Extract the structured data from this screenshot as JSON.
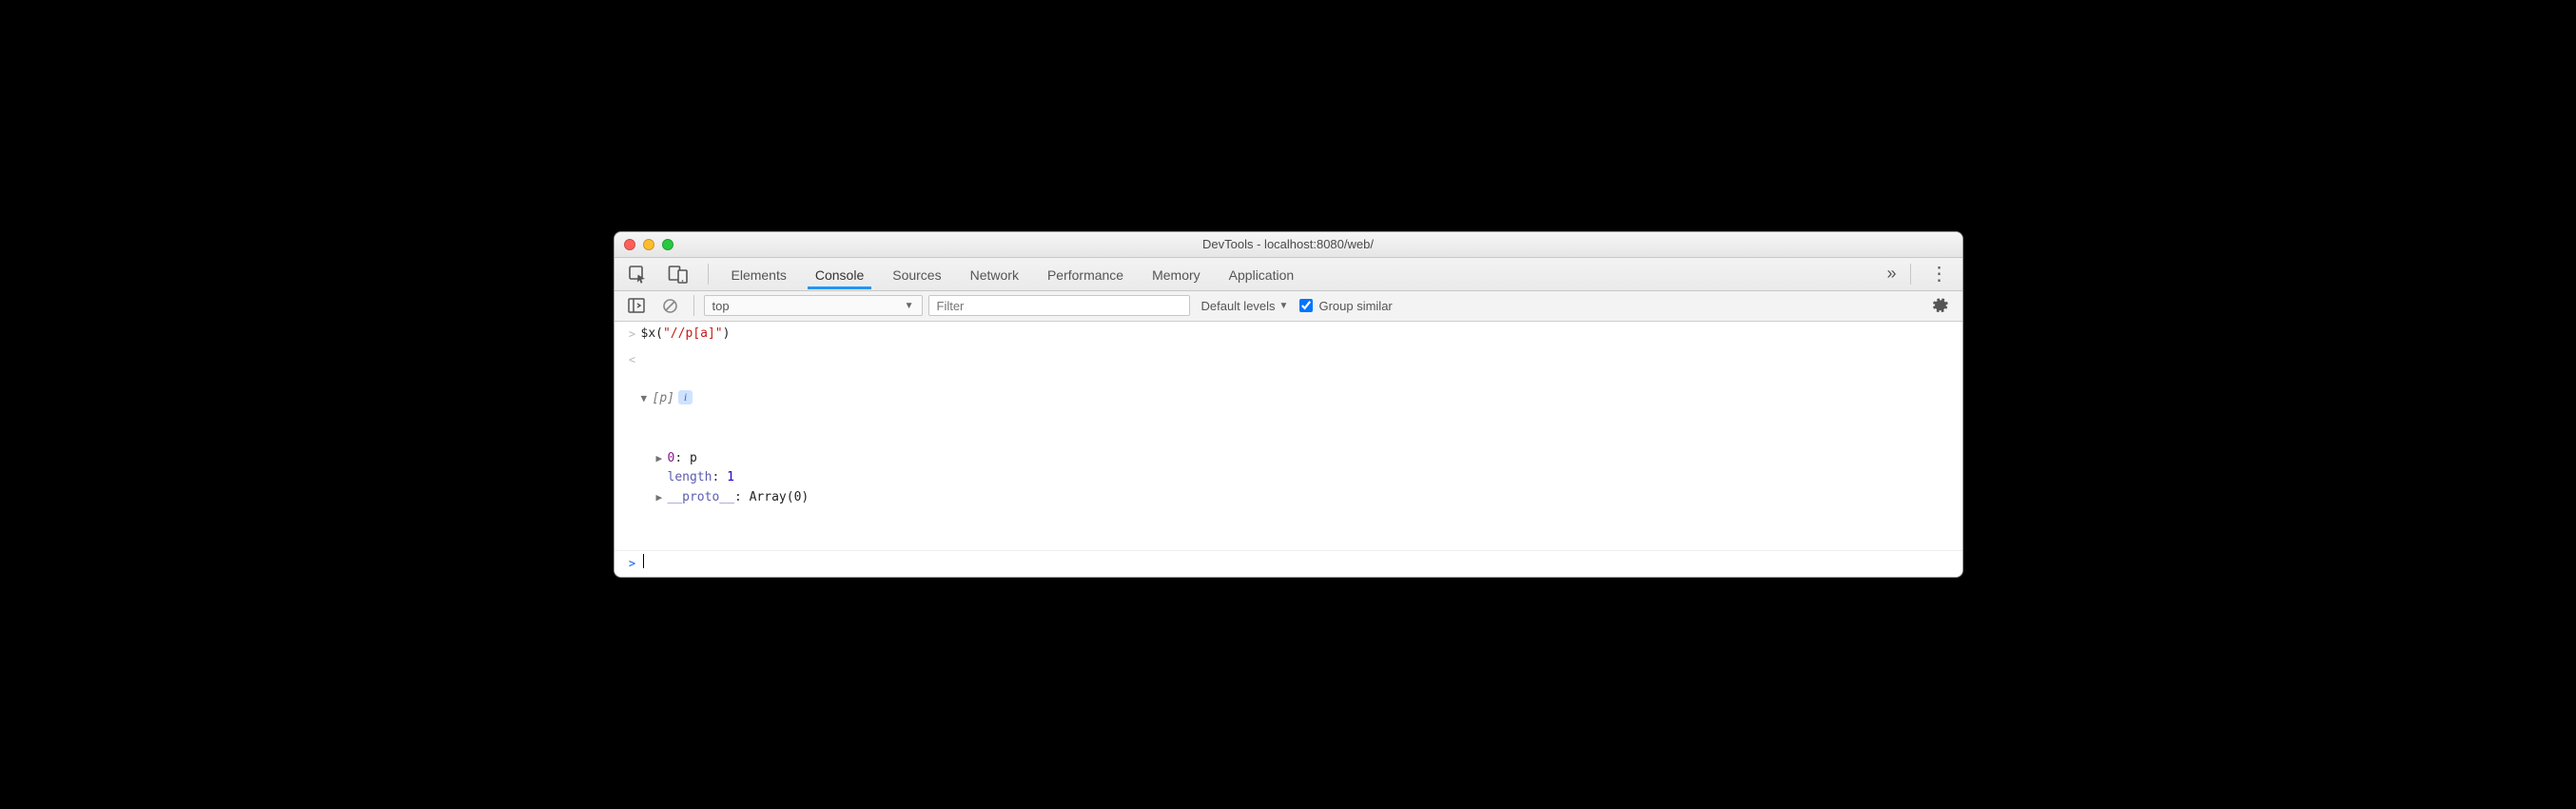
{
  "window": {
    "title": "DevTools - localhost:8080/web/"
  },
  "tabs": [
    "Elements",
    "Console",
    "Sources",
    "Network",
    "Performance",
    "Memory",
    "Application"
  ],
  "active_tab_index": 1,
  "toolbar": {
    "context": "top",
    "filter_placeholder": "Filter",
    "levels_label": "Default levels",
    "group_similar_label": "Group similar",
    "group_similar_checked": true
  },
  "console": {
    "command": {
      "fn": "$x",
      "open": "(",
      "arg": "\"//p[a]\"",
      "close": ")"
    },
    "result": {
      "summary_open": "[",
      "summary_inner": "p",
      "summary_close": "]",
      "props": [
        {
          "expandable": true,
          "key": "0",
          "sep": ": ",
          "val": "p",
          "valClass": "obj-val-o"
        },
        {
          "expandable": false,
          "key": "length",
          "sep": ": ",
          "val": "1",
          "valClass": "obj-val-n"
        },
        {
          "expandable": true,
          "key": "__proto__",
          "sep": ": ",
          "val": "Array(0)",
          "valClass": "obj-val-o"
        }
      ]
    },
    "info_badge": "i",
    "prompt_caret": ">"
  },
  "glyphs": {
    "input_caret": ">",
    "output_caret": "<",
    "arrow_right": "▶",
    "arrow_down": "▼",
    "levels_arrow": "▼",
    "more": "»",
    "kebab": "⋮"
  }
}
